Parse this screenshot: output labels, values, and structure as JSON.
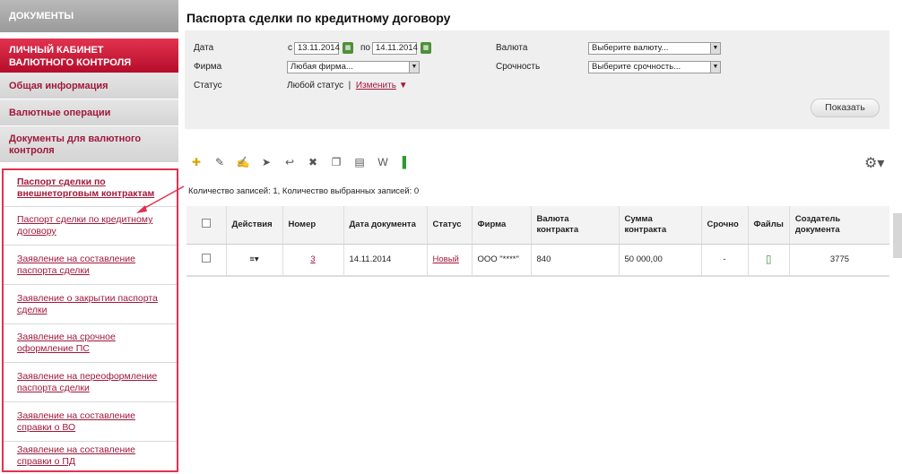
{
  "sidebar": {
    "docs_header": "ДОКУМЕНТЫ",
    "cabinet": "ЛИЧНЫЙ КАБИНЕТ ВАЛЮТНОГО КОНТРОЛЯ",
    "items": [
      "Общая информация",
      "Валютные операции",
      "Документы для валютного контроля"
    ],
    "subitems": [
      "Паспорт сделки по внешнеторговым контрактам",
      "Паспорт сделки по кредитному договору",
      "Заявление на составление паспорта сделки",
      "Заявление о закрытии паспорта сделки",
      "Заявление на срочное оформление ПС",
      "Заявление на переоформление паспорта сделки",
      "Заявление на составление справки о ВО",
      "Заявление на составление справки о ПД"
    ]
  },
  "page_title": "Паспорта сделки по кредитному договору",
  "filter": {
    "date_label": "Дата",
    "from": "с",
    "date_from": "13.11.2014",
    "to": "по",
    "date_to": "14.11.2014",
    "firm_label": "Фирма",
    "firm_value": "Любая фирма...",
    "status_label": "Статус",
    "status_value": "Любой статус",
    "change": "Изменить",
    "currency_label": "Валюта",
    "currency_value": "Выберите валюту...",
    "urgency_label": "Срочность",
    "urgency_value": "Выберите срочность...",
    "show_button": "Показать"
  },
  "counts": "Количество записей: 1, Количество выбранных записей: 0",
  "table": {
    "headers": [
      "",
      "Действия",
      "Номер",
      "Дата документа",
      "Статус",
      "Фирма",
      "Валюта контракта",
      "Сумма контракта",
      "Срочно",
      "Файлы",
      "Создатель документа"
    ],
    "row": {
      "number": "3",
      "date": "14.11.2014",
      "status": "Новый",
      "firm": "ООО \"****\"",
      "currency": "840",
      "amount": "50 000,00",
      "urgent": "-",
      "creator": "3775"
    }
  }
}
